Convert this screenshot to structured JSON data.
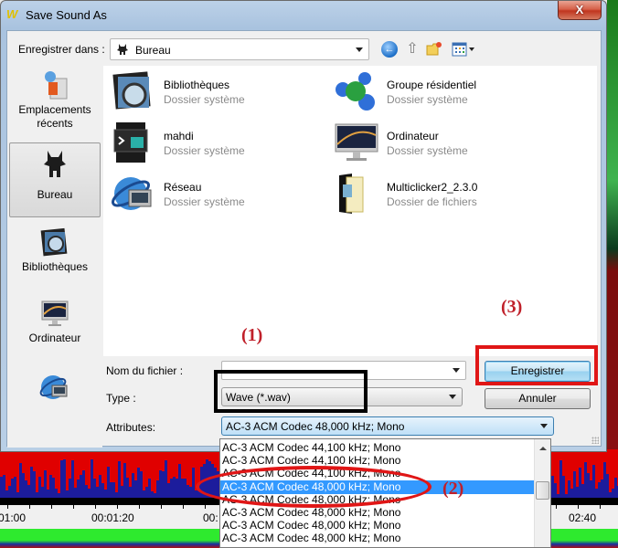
{
  "window": {
    "title": "Save Sound As",
    "app_logo": "W",
    "close_label": "X"
  },
  "toolbar": {
    "save_in_label": "Enregistrer dans :",
    "location": "Bureau",
    "icons": [
      "back-icon",
      "up-folder-icon",
      "new-folder-icon",
      "views-menu-icon"
    ]
  },
  "places": [
    {
      "label": "Emplacements récents",
      "icon": "recent-places-icon"
    },
    {
      "label": "Bureau",
      "icon": "desktop-icon",
      "selected": true
    },
    {
      "label": "Bibliothèques",
      "icon": "libraries-icon"
    },
    {
      "label": "Ordinateur",
      "icon": "computer-icon"
    },
    {
      "label": "",
      "icon": "network-icon"
    }
  ],
  "files": [
    {
      "name": "Bibliothèques",
      "type": "Dossier système",
      "icon": "libraries-icon"
    },
    {
      "name": "Groupe résidentiel",
      "type": "Dossier système",
      "icon": "homegroup-icon"
    },
    {
      "name": "mahdi",
      "type": "Dossier système",
      "icon": "user-folder-icon"
    },
    {
      "name": "Ordinateur",
      "type": "Dossier système",
      "icon": "computer-icon"
    },
    {
      "name": "Réseau",
      "type": "Dossier système",
      "icon": "network-icon"
    },
    {
      "name": "Multiclicker2_2.3.0",
      "type": "Dossier de fichiers",
      "icon": "folder-icon"
    }
  ],
  "form": {
    "filename_label": "Nom du fichier :",
    "filename_value": "",
    "type_label": "Type :",
    "type_value": "Wave (*.wav)",
    "attributes_label": "Attributes:",
    "attributes_value": "AC-3 ACM Codec 48,000 kHz; Mono"
  },
  "buttons": {
    "save": "Enregistrer",
    "cancel": "Annuler"
  },
  "annotations": {
    "step1": "(1)",
    "step2": "(2)",
    "step3": "(3)"
  },
  "attributes_dropdown": {
    "items": [
      "AC-3 ACM Codec 44,100 kHz; Mono",
      "AC-3 ACM Codec 44,100 kHz; Mono",
      "AC-3 ACM Codec 44,100 kHz; Mono",
      "AC-3 ACM Codec 48,000 kHz; Mono",
      "AC-3 ACM Codec 48,000 kHz; Mono",
      "AC-3 ACM Codec 48,000 kHz; Mono",
      "AC-3 ACM Codec 48,000 kHz; Mono",
      "AC-3 ACM Codec 48,000 kHz; Mono"
    ],
    "selected_index": 3
  },
  "background_app": {
    "time_labels": [
      "01:00",
      "00:01:20",
      "00:",
      "02:40"
    ]
  },
  "colors": {
    "selection": "#3399ff",
    "annotation_red": "#e01616",
    "annotation_text": "#c0202a",
    "waveform_red": "#e00000",
    "waveform_blue": "#1c1c9c",
    "track_green": "#2eea2e"
  }
}
